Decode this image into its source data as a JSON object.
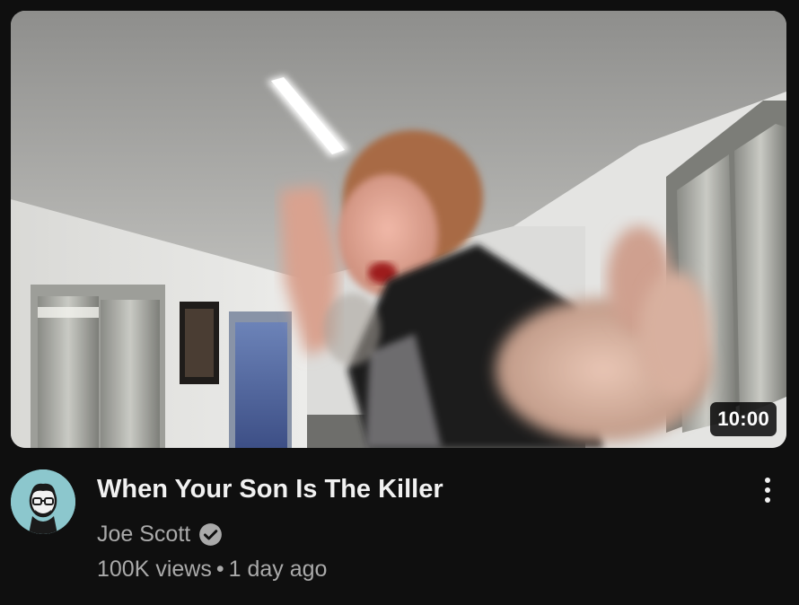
{
  "video": {
    "duration": "10:00",
    "title": "When Your Son Is The Killer",
    "channel": "Joe Scott",
    "views": "100K views",
    "separator": "•",
    "age": "1 day ago",
    "verified_icon": "verified-check-icon",
    "menu_icon": "more-vertical-icon",
    "avatar_icon": "channel-avatar-cartoon-face"
  },
  "colors": {
    "background": "#0f0f0f",
    "title": "#f1f1f1",
    "secondary_text": "#aaaaaa",
    "avatar_bg": "#8cc7cd"
  }
}
